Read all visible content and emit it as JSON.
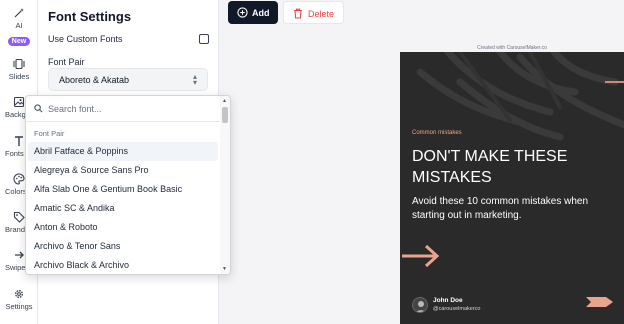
{
  "rail": {
    "items": [
      {
        "label": "AI",
        "badge": "New",
        "icon": "magic-wand-icon"
      },
      {
        "label": "Slides",
        "icon": "slides-icon"
      },
      {
        "label": "Backgr",
        "icon": "image-icon"
      },
      {
        "label": "Fonts",
        "icon": "text-icon"
      },
      {
        "label": "Colors",
        "icon": "palette-icon"
      },
      {
        "label": "Branding",
        "icon": "tag-icon"
      },
      {
        "label": "Swipe",
        "icon": "arrow-right-icon"
      },
      {
        "label": "Settings",
        "icon": "gear-icon"
      }
    ]
  },
  "panel": {
    "title": "Font Settings",
    "use_custom_fonts_label": "Use Custom Fonts",
    "use_custom_fonts_checked": false,
    "font_pair_label": "Font Pair",
    "font_pair_value": "Aboreto & Akatab"
  },
  "dropdown": {
    "search_placeholder": "Search font...",
    "search_value": "",
    "group_label": "Font Pair",
    "highlighted_index": 0,
    "options": [
      "Abril Fatface & Poppins",
      "Alegreya & Source Sans Pro",
      "Alfa Slab One & Gentium Book Basic",
      "Amatic SC & Andika",
      "Anton & Roboto",
      "Archivo & Tenor Sans",
      "Archivo Black & Archivo"
    ]
  },
  "toolbar": {
    "add_label": "Add",
    "delete_label": "Delete",
    "delete_color": "#ef4444"
  },
  "slide": {
    "credit": "Created with CarouselMaker.co",
    "kicker": "Common mistakes",
    "headline": "DON'T MAKE THESE MISTAKES",
    "subtitle": "Avoid these 10 common mistakes when starting out in marketing.",
    "author_name": "John Doe",
    "author_handle": "@carouselmakerco",
    "accent_color": "#e8a48c",
    "background_color": "#2a2a2a"
  }
}
